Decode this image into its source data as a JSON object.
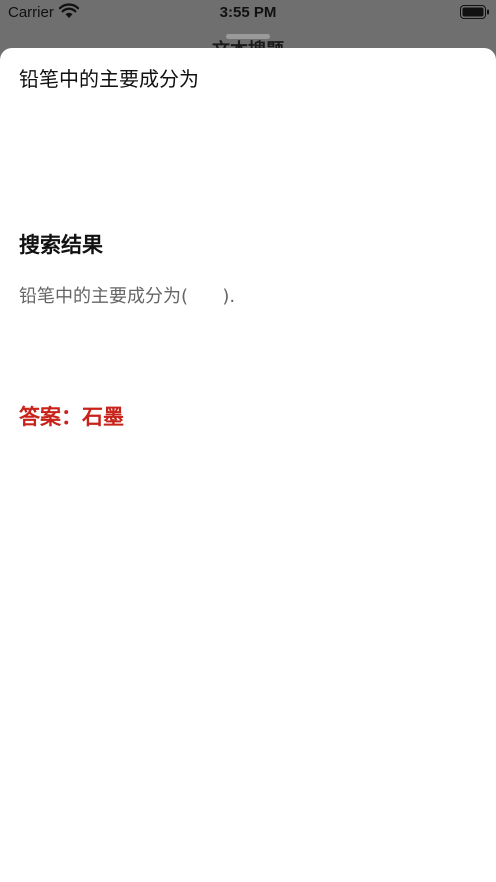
{
  "status_bar": {
    "carrier": "Carrier",
    "time": "3:55 PM",
    "wifi_icon": "wifi-icon",
    "battery_icon": "battery-icon"
  },
  "background_nav": {
    "title": "文本搜题"
  },
  "sheet": {
    "grabber_icon": "grabber-handle",
    "question": "铅笔中的主要成分为",
    "results_heading": "搜索结果",
    "result_text": "铅笔中的主要成分为(      ).",
    "answer": "答案：石墨",
    "answer_color": "#c8231a"
  }
}
